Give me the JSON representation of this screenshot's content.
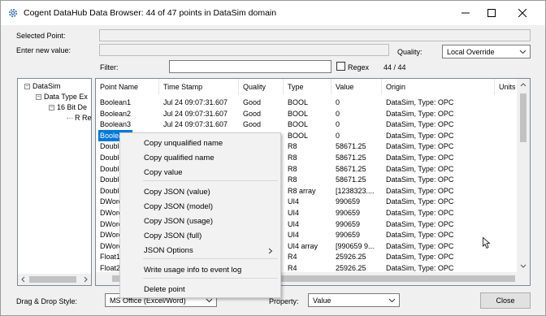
{
  "window": {
    "title": "Cogent DataHub Data Browser: 44 of 47 points in DataSim domain",
    "minimize_icon": "minimize-icon",
    "maximize_icon": "maximize-icon",
    "close_icon": "close-icon"
  },
  "form": {
    "selected_point_label": "Selected Point:",
    "enter_value_label": "Enter new value:",
    "quality_label": "Quality:",
    "quality_value": "Local Override",
    "filter_label": "Filter:",
    "filter_value": "",
    "regex_label": "Regex",
    "count": "44 / 44"
  },
  "tree": {
    "items": [
      "DataSim",
      "Data Type Ex",
      "16 Bit De",
      "R Re"
    ]
  },
  "table": {
    "columns": [
      "Point Name",
      "Time Stamp",
      "Quality",
      "Type",
      "Value",
      "Origin",
      "Units"
    ],
    "rows": [
      [
        "Boolean1",
        "Jul 24 09:07:31.607",
        "Good",
        "BOOL",
        "0",
        "DataSim, Type: OPC",
        ""
      ],
      [
        "Boolean2",
        "Jul 24 09:07:31.607",
        "Good",
        "BOOL",
        "0",
        "DataSim, Type: OPC",
        ""
      ],
      [
        "Boolean3",
        "Jul 24 09:07:31.607",
        "Good",
        "BOOL",
        "0",
        "DataSim, Type: OPC",
        ""
      ],
      [
        "Boolean4",
        "Jul 24 09:07:31.607",
        "Good",
        "BOOL",
        "0",
        "DataSim, Type: OPC",
        ""
      ],
      [
        "Double",
        "",
        "",
        "R8",
        "58671.25",
        "DataSim, Type: OPC",
        ""
      ],
      [
        "Double",
        "",
        "",
        "R8",
        "58671.25",
        "DataSim, Type: OPC",
        ""
      ],
      [
        "Double",
        "",
        "",
        "R8",
        "58671.25",
        "DataSim, Type: OPC",
        ""
      ],
      [
        "Double",
        "",
        "",
        "R8",
        "58671.25",
        "DataSim, Type: OPC",
        ""
      ],
      [
        "Double",
        "",
        "",
        "R8 array",
        "[1238323....",
        "DataSim, Type: OPC",
        ""
      ],
      [
        "DWord",
        "",
        "",
        "UI4",
        "990659",
        "DataSim, Type: OPC",
        ""
      ],
      [
        "DWord",
        "",
        "",
        "UI4",
        "990659",
        "DataSim, Type: OPC",
        ""
      ],
      [
        "DWord",
        "",
        "",
        "UI4",
        "990659",
        "DataSim, Type: OPC",
        ""
      ],
      [
        "DWord",
        "",
        "",
        "UI4",
        "990659",
        "DataSim, Type: OPC",
        ""
      ],
      [
        "DWord",
        "",
        "",
        "UI4 array",
        "[990659 9...",
        "DataSim, Type: OPC",
        ""
      ],
      [
        "Float1",
        "",
        "",
        "R4",
        "25926.25",
        "DataSim, Type: OPC",
        ""
      ],
      [
        "Float2",
        "",
        "",
        "R4",
        "25926.25",
        "DataSim, Type: OPC",
        ""
      ]
    ]
  },
  "context_menu": {
    "items": [
      "Copy unqualified name",
      "Copy qualified name",
      "Copy value",
      "Copy JSON (value)",
      "Copy JSON (model)",
      "Copy JSON (usage)",
      "Copy JSON (full)",
      "JSON Options",
      "Write usage info to event log",
      "Delete point"
    ]
  },
  "footer": {
    "drag_drop_label": "Drag & Drop Style:",
    "drag_drop_value": "MS Office (Excel/Word)",
    "property_label": "Property:",
    "property_value": "Value",
    "close_label": "Close"
  },
  "colors": {
    "selection": "#0078d7",
    "window_bg": "#f0f0f0"
  }
}
